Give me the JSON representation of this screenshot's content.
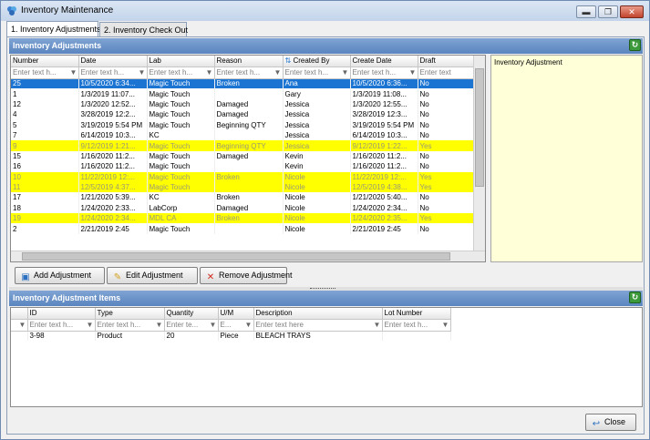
{
  "window": {
    "title": "Inventory Maintenance",
    "minimize": "▬",
    "restore": "❐",
    "close": "✕"
  },
  "tabs": [
    {
      "label": "1. Inventory Adjustments"
    },
    {
      "label": "2. Inventory Check Out"
    }
  ],
  "adjustments": {
    "header": "Inventory Adjustments",
    "columns": [
      "Number",
      "Date",
      "Lab",
      "Reason",
      "Created By",
      "Create Date",
      "Draft"
    ],
    "filter_placeholders": [
      "Enter text h...",
      "Enter text h...",
      "Enter text h...",
      "Enter text h...",
      "Enter text h...",
      "Enter text h...",
      "Enter text"
    ],
    "rows": [
      [
        "25",
        "10/5/2020 6:34...",
        "Magic Touch",
        "Broken",
        "Ana",
        "10/5/2020 6:36...",
        "No"
      ],
      [
        "1",
        "1/3/2019 11:07...",
        "Magic Touch",
        "",
        "Gary",
        "1/3/2019 11:08...",
        "No"
      ],
      [
        "12",
        "1/3/2020 12:52...",
        "Magic Touch",
        "Damaged",
        "Jessica",
        "1/3/2020 12:55...",
        "No"
      ],
      [
        "4",
        "3/28/2019 12:2...",
        "Magic Touch",
        "Damaged",
        "Jessica",
        "3/28/2019 12:3...",
        "No"
      ],
      [
        "5",
        "3/19/2019 5:54 PM",
        "Magic Touch",
        "Beginning QTY",
        "Jessica",
        "3/19/2019 5:54 PM",
        "No"
      ],
      [
        "7",
        "6/14/2019 10:3...",
        "KC",
        "",
        "Jessica",
        "6/14/2019 10:3...",
        "No"
      ],
      [
        "9",
        "9/12/2019 1:21...",
        "Magic Touch",
        "Beginning QTY",
        "Jessica",
        "9/12/2019 1:22...",
        "Yes"
      ],
      [
        "15",
        "1/16/2020 11:2...",
        "Magic Touch",
        "Damaged",
        "Kevin",
        "1/16/2020 11:2...",
        "No"
      ],
      [
        "16",
        "1/16/2020 11:2...",
        "Magic Touch",
        "",
        "Kevin",
        "1/16/2020 11:2...",
        "No"
      ],
      [
        "10",
        "11/22/2019 12:...",
        "Magic Touch",
        "Broken",
        "Nicole",
        "11/22/2019 12:...",
        "Yes"
      ],
      [
        "11",
        "12/5/2019 4:37...",
        "Magic Touch",
        "",
        "Nicole",
        "12/5/2019 4:38...",
        "Yes"
      ],
      [
        "17",
        "1/21/2020 5:39...",
        "KC",
        "Broken",
        "Nicole",
        "1/21/2020 5:40...",
        "No"
      ],
      [
        "18",
        "1/24/2020 2:33...",
        "LabCorp",
        "Damaged",
        "Nicole",
        "1/24/2020 2:34...",
        "No"
      ],
      [
        "19",
        "1/24/2020 2:34...",
        "MDL CA",
        "Broken",
        "Nicole",
        "1/24/2020 2:35...",
        "Yes"
      ],
      [
        "2",
        "2/21/2019 2:45",
        "Magic Touch",
        "",
        "Nicole",
        "2/21/2019 2:45",
        "No"
      ]
    ],
    "row_states": [
      "selected",
      "",
      "",
      "",
      "",
      "",
      "draft",
      "",
      "",
      "draft",
      "draft",
      "",
      "",
      "draft",
      ""
    ],
    "notes_text": "Inventory Adjustment"
  },
  "buttons": {
    "add": "Add Adjustment",
    "edit": "Edit Adjustment",
    "remove": "Remove Adjustment",
    "close": "Close"
  },
  "items": {
    "header": "Inventory Adjustment Items",
    "columns": [
      "ID",
      "Type",
      "Quantity",
      "U/M",
      "Description",
      "Lot Number"
    ],
    "filter_placeholders": [
      "Enter text h...",
      "Enter text h...",
      "Enter te...",
      "E...",
      "Enter text here",
      "Enter text h..."
    ],
    "rows": [
      [
        "3-98",
        "Product",
        "20",
        "Piece",
        "BLEACH TRAYS",
        ""
      ]
    ]
  },
  "colors": {
    "header_blue": "#5b85bf",
    "selected_row": "#1b74d2",
    "draft_row": "#ffff00",
    "notes_bg": "#ffffd8"
  }
}
